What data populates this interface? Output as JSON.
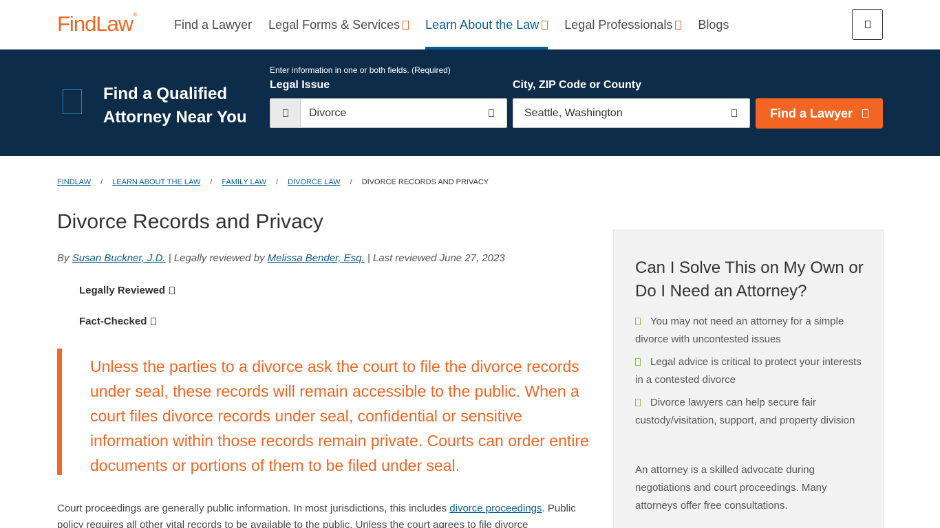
{
  "header": {
    "logo": "FindLaw",
    "nav": [
      {
        "label": "Find a Lawyer"
      },
      {
        "label": "Legal Forms & Services"
      },
      {
        "label": "Learn About the Law"
      },
      {
        "label": "Legal Professionals"
      },
      {
        "label": "Blogs"
      }
    ]
  },
  "search": {
    "title_line1": "Find a Qualified",
    "title_line2": "Attorney Near You",
    "hint": "Enter information in one or both fields. (Required)",
    "legal_issue_label": "Legal Issue",
    "legal_issue_value": "Divorce",
    "location_label": "City, ZIP Code or County",
    "location_value": "Seattle, Washington",
    "button": "Find a Lawyer"
  },
  "breadcrumb": {
    "items": [
      "FINDLAW",
      "LEARN ABOUT THE LAW",
      "FAMILY LAW",
      "DIVORCE LAW"
    ],
    "current": "DIVORCE RECORDS AND PRIVACY",
    "separator": "/"
  },
  "article": {
    "title": "Divorce Records and Privacy",
    "by_prefix": "By",
    "author": "Susan Buckner, J.D.",
    "reviewed_prefix": "| Legally reviewed by",
    "reviewer": "Melissa Bender, Esq.",
    "reviewed_suffix": "| Last reviewed June 27, 2023",
    "badge1": "Legally Reviewed",
    "badge2": "Fact-Checked",
    "quote": "Unless the parties to a divorce ask the court to file the divorce records under seal, these records will remain accessible to the public.  When a court files divorce records under seal, confidential or sensitive information within those records remain private. Courts can order entire documents or portions of them to be filed under seal.",
    "body_start": "Court proceedings are generally public information. In most jurisdictions, this includes ",
    "body_link": "divorce proceedings",
    "body_end": ". Public policy requires all other vital records to be available to the public. Unless the court agrees to file divorce"
  },
  "sidebar": {
    "title": "Can I Solve This on My Own or Do I Need an Attorney?",
    "items": [
      "You may not need an attorney for a simple divorce with uncontested issues",
      "Legal advice is critical to protect your interests in a contested divorce",
      "Divorce lawyers can help secure fair custody/visitation, support, and property division"
    ],
    "paragraph": "An attorney is a skilled advocate during negotiations and court proceedings. Many attorneys offer free consultations."
  },
  "colors": {
    "brand_orange": "#f26522",
    "navy": "#0d2c4a",
    "link_blue": "#0b5d8f"
  },
  "icons": [
    "menu-icon",
    "id-card-icon",
    "briefcase-icon",
    "dropdown-icon",
    "location-icon",
    "arrow-right-icon",
    "check-icon"
  ]
}
